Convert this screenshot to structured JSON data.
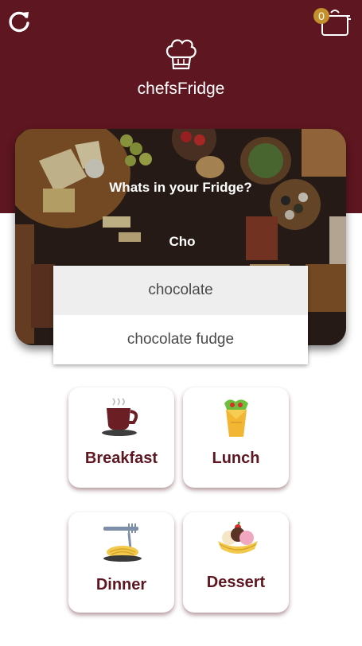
{
  "app": {
    "title": "chefsFridge"
  },
  "cart": {
    "count": "0"
  },
  "search": {
    "question": "Whats in your Fridge?",
    "value": "Cho",
    "suggestions": [
      "chocolate",
      "chocolate fudge"
    ]
  },
  "categories": [
    {
      "label": "Breakfast",
      "icon": "coffee-cup-icon"
    },
    {
      "label": "Lunch",
      "icon": "burrito-icon"
    },
    {
      "label": "Dinner",
      "icon": "pasta-plate-icon"
    },
    {
      "label": "Dessert",
      "icon": "banana-split-icon"
    }
  ],
  "colors": {
    "brand": "#5e1620",
    "accent": "#c4902e",
    "card_bg": "#ffffff"
  }
}
